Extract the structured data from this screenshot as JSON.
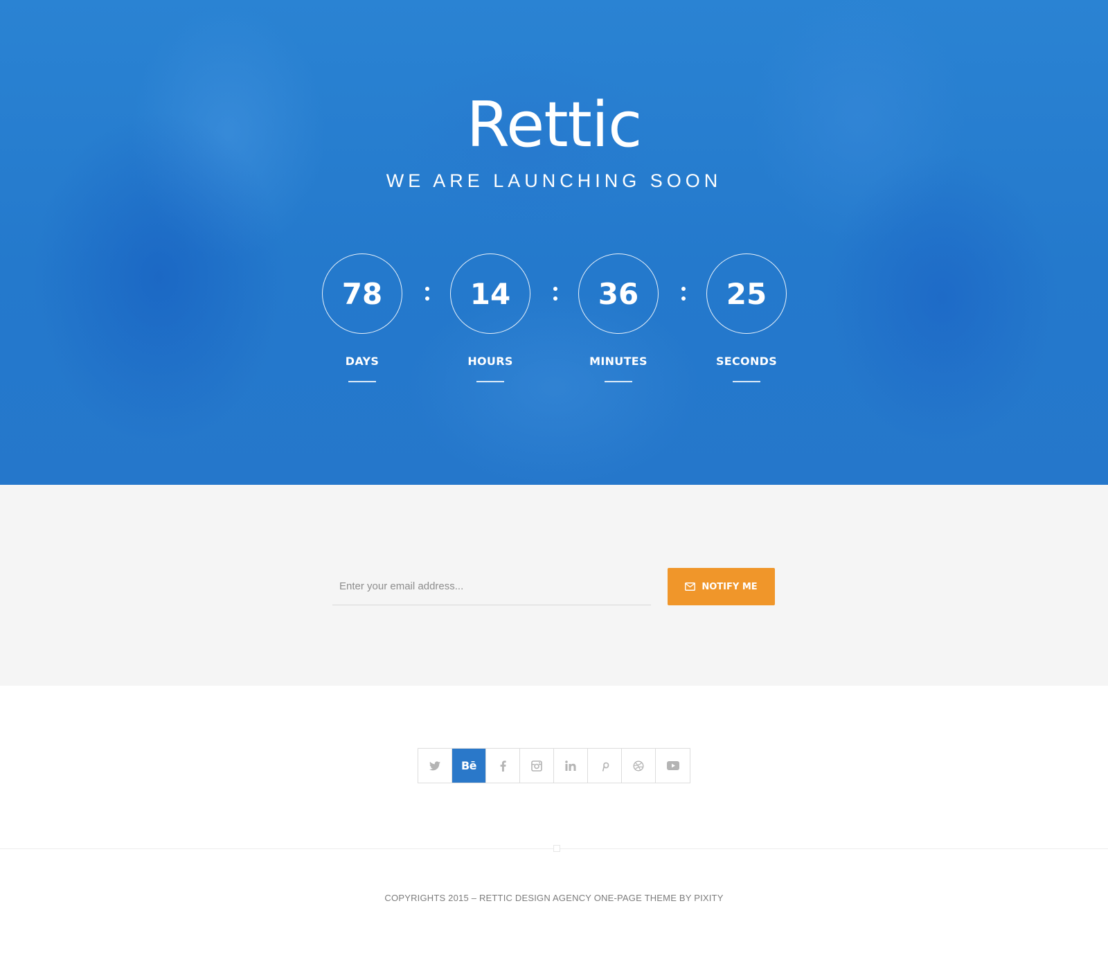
{
  "hero": {
    "brand": "Rettic",
    "tagline": "WE ARE LAUNCHING SOON",
    "countdown": [
      {
        "value": "78",
        "label": "DAYS"
      },
      {
        "value": "14",
        "label": "HOURS"
      },
      {
        "value": "36",
        "label": "MINUTES"
      },
      {
        "value": "25",
        "label": "SECONDS"
      }
    ],
    "colors": {
      "background": "#2a7fd0",
      "text": "#ffffff"
    }
  },
  "subscribe": {
    "email_placeholder": "Enter your email address...",
    "email_value": "",
    "button_label": "NOTIFY ME",
    "button_icon": "mail-icon",
    "button_color": "#f0962a"
  },
  "social": {
    "items": [
      {
        "name": "twitter",
        "icon": "twitter-icon",
        "active": false
      },
      {
        "name": "behance",
        "icon": "behance-icon",
        "label": "Bē",
        "active": true
      },
      {
        "name": "facebook",
        "icon": "facebook-icon",
        "active": false
      },
      {
        "name": "instagram",
        "icon": "instagram-icon",
        "active": false
      },
      {
        "name": "linkedin",
        "icon": "linkedin-icon",
        "active": false
      },
      {
        "name": "pinterest",
        "icon": "pinterest-icon",
        "active": false
      },
      {
        "name": "dribbble",
        "icon": "dribbble-icon",
        "active": false
      },
      {
        "name": "youtube",
        "icon": "youtube-icon",
        "active": false
      }
    ],
    "active_color": "#2a78c9"
  },
  "footer": {
    "copyright": "COPYRIGHTS 2015 – RETTIC DESIGN AGENCY ONE-PAGE THEME BY PIXITY"
  }
}
